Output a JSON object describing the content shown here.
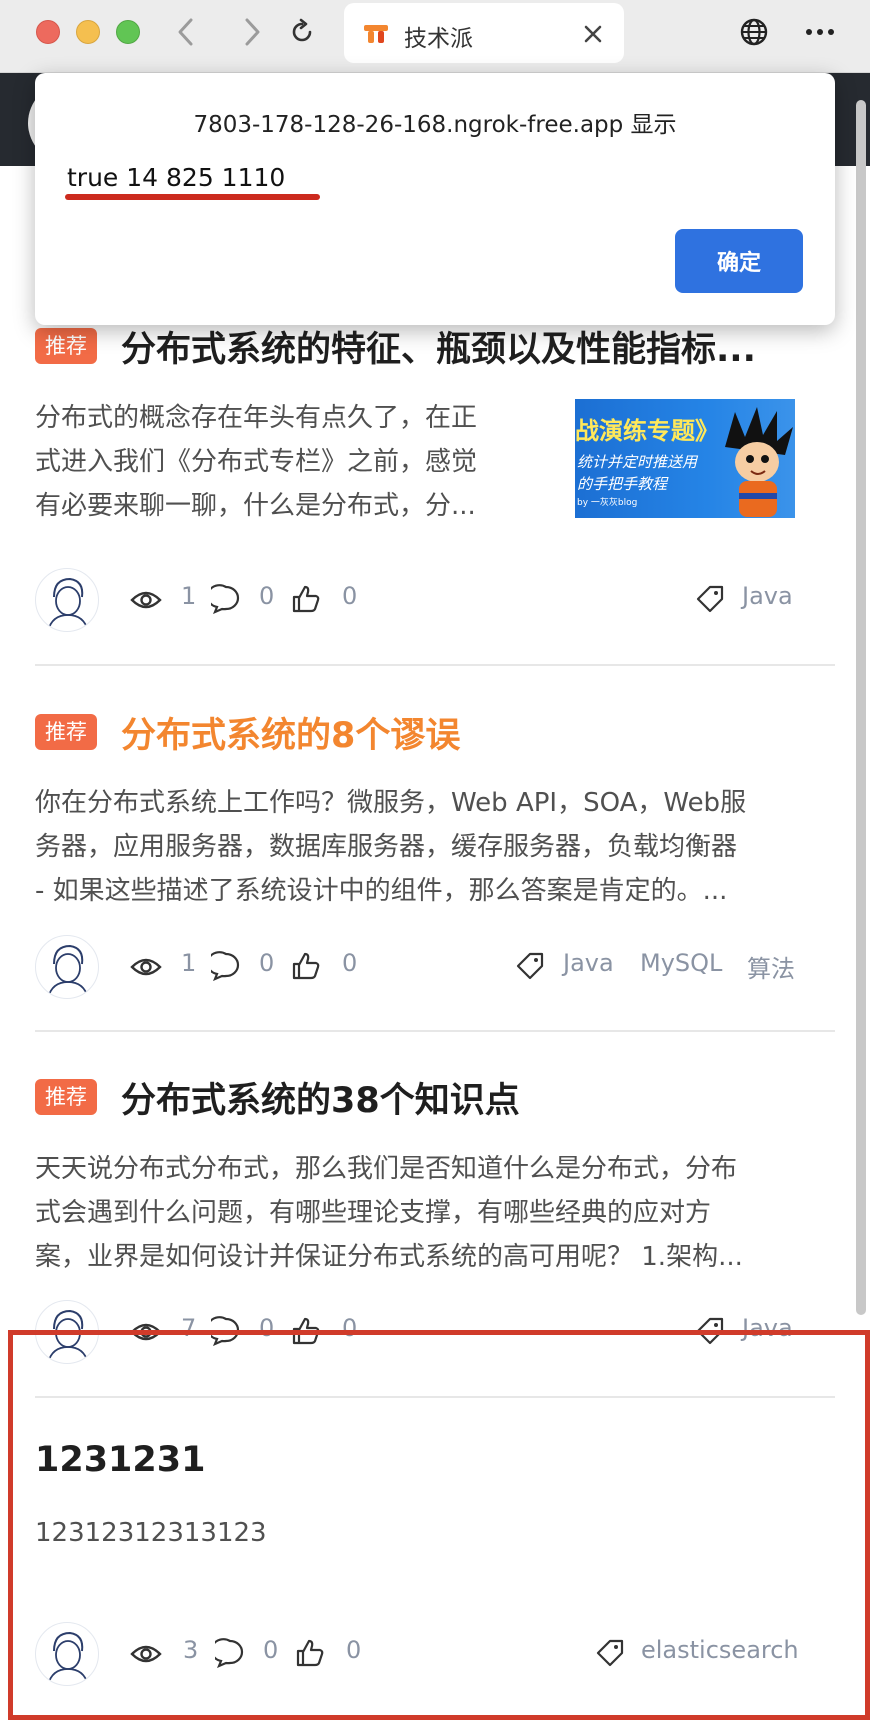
{
  "browser": {
    "tab_title": "技术派",
    "accent_color": "#f3862f"
  },
  "dialog": {
    "origin": "7803-178-128-26-168.ngrok-free.app 显示",
    "message": "true 14 825 1110",
    "ok_label": "确定"
  },
  "articles": [
    {
      "badge": "推荐",
      "title": "分布式系统的特征、瓶颈以及性能指标...",
      "desc_lines": [
        "分布式的概念存在年头有点久了，在正",
        "式进入我们《分布式专栏》之前，感觉",
        "有必要来聊一聊，什么是分布式，分..."
      ],
      "thumb_lines": [
        "战演练专题》",
        "统计并定时推送用",
        "的手把手教程",
        "by 一灰灰blog"
      ],
      "views": "1",
      "comments": "0",
      "likes": "0",
      "tags": [
        "Java"
      ]
    },
    {
      "badge": "推荐",
      "title": "分布式系统的8个谬误",
      "desc_lines": [
        "你在分布式系统上工作吗？微服务，Web API，SOA，Web服",
        "务器，应用服务器，数据库服务器，缓存服务器，负载均衡器",
        "- 如果这些描述了系统设计中的组件，那么答案是肯定的。..."
      ],
      "views": "1",
      "comments": "0",
      "likes": "0",
      "tags": [
        "Java",
        "MySQL",
        "算法"
      ]
    },
    {
      "badge": "推荐",
      "title": "分布式系统的38个知识点",
      "desc_lines": [
        "天天说分布式分布式，那么我们是否知道什么是分布式，分布",
        "式会遇到什么问题，有哪些理论支撑，有哪些经典的应对方",
        "案，业界是如何设计并保证分布式系统的高可用呢？ 1.架构..."
      ],
      "views": "7",
      "comments": "0",
      "likes": "0",
      "tags": [
        "Java"
      ]
    },
    {
      "title": "1231231",
      "desc": "12312312313123",
      "views": "3",
      "comments": "0",
      "likes": "0",
      "tags": [
        "elasticsearch"
      ]
    }
  ]
}
